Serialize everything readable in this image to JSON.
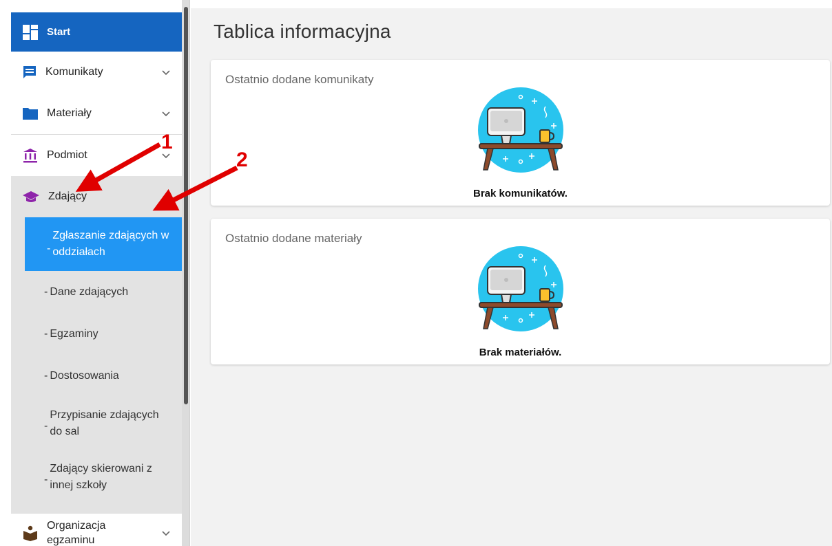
{
  "sidebar": {
    "items": [
      {
        "label": "Start",
        "icon": "dashboard-icon"
      },
      {
        "label": "Komunikaty",
        "icon": "message-icon"
      },
      {
        "label": "Materiały",
        "icon": "folder-icon"
      },
      {
        "label": "Podmiot",
        "icon": "institution-icon"
      },
      {
        "label": "Zdający",
        "icon": "graduation-cap-icon"
      },
      {
        "label": "Organizacja egzaminu",
        "icon": "teacher-icon"
      }
    ],
    "sub_items": [
      {
        "dash": "-",
        "label": "Zgłaszanie zdających w oddziałach",
        "active": true
      },
      {
        "dash": "-",
        "label": "Dane zdających"
      },
      {
        "dash": "-",
        "label": "Egzaminy"
      },
      {
        "dash": "-",
        "label": "Dostosowania"
      },
      {
        "dash": "-",
        "label": "Przypisanie zdających do sal"
      },
      {
        "dash": "-",
        "label": "Zdający skierowani z innej szkoły"
      }
    ]
  },
  "main": {
    "title": "Tablica informacyjna",
    "cards": [
      {
        "title": "Ostatnio dodane komunikaty",
        "empty_text": "Brak komunikatów."
      },
      {
        "title": "Ostatnio dodane materiały",
        "empty_text": "Brak materiałów."
      }
    ]
  },
  "annotations": {
    "arrow1": "1",
    "arrow2": "2"
  },
  "colors": {
    "start_bg": "#1565c0",
    "active_sub_bg": "#2196f3",
    "group_bg": "#e3e3e3",
    "main_bg": "#f2f2f2",
    "annotation_red": "#e00000",
    "illustration_circle": "#29c4ee"
  }
}
